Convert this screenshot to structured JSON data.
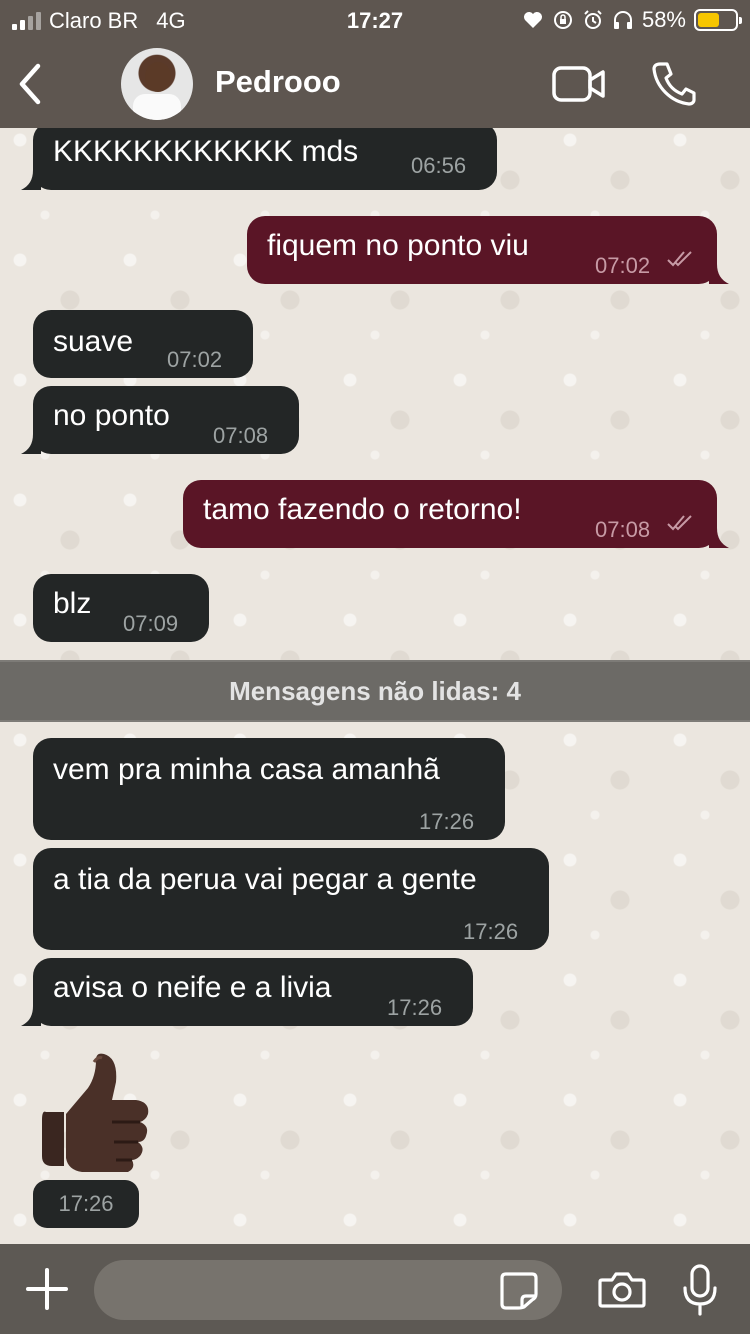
{
  "status_bar": {
    "carrier": "Claro BR",
    "network": "4G",
    "time": "17:27",
    "battery_percent": "58%",
    "battery_level": 0.58
  },
  "header": {
    "contact_name": "Pedrooo",
    "back_icon": "chevron-left-icon",
    "video_icon": "video-camera-icon",
    "call_icon": "phone-icon"
  },
  "messages": [
    {
      "direction": "in",
      "text": "KKKKKKKKKKKK mds",
      "time": "06:56"
    },
    {
      "direction": "out",
      "text": "fiquem no ponto viu",
      "time": "07:02",
      "status": "read"
    },
    {
      "direction": "in",
      "text": "suave",
      "time": "07:02"
    },
    {
      "direction": "in",
      "text": "no ponto",
      "time": "07:08"
    },
    {
      "direction": "out",
      "text": "tamo fazendo o retorno!",
      "time": "07:08",
      "status": "read"
    },
    {
      "direction": "in",
      "text": "blz",
      "time": "07:09"
    },
    {
      "direction": "in",
      "text": "vem pra minha casa amanhã",
      "time": "17:26"
    },
    {
      "direction": "in",
      "text": "a tia da perua vai pegar a gente",
      "time": "17:26"
    },
    {
      "direction": "in",
      "text": "avisa o neife e a livia",
      "time": "17:26"
    },
    {
      "direction": "in",
      "type": "emoji",
      "emoji_icon": "thumbs-up-icon",
      "time": "17:26"
    }
  ],
  "unread_divider": "Mensagens não lidas: 4",
  "input_bar": {
    "placeholder": "",
    "value": "",
    "icons": [
      "plus-icon",
      "sticker-icon",
      "camera-icon",
      "microphone-icon"
    ]
  },
  "colors": {
    "incoming_bubble": "#232626",
    "outgoing_bubble": "#5a1526",
    "header_bg": "#5e5650",
    "battery_fill": "#f7c600"
  }
}
